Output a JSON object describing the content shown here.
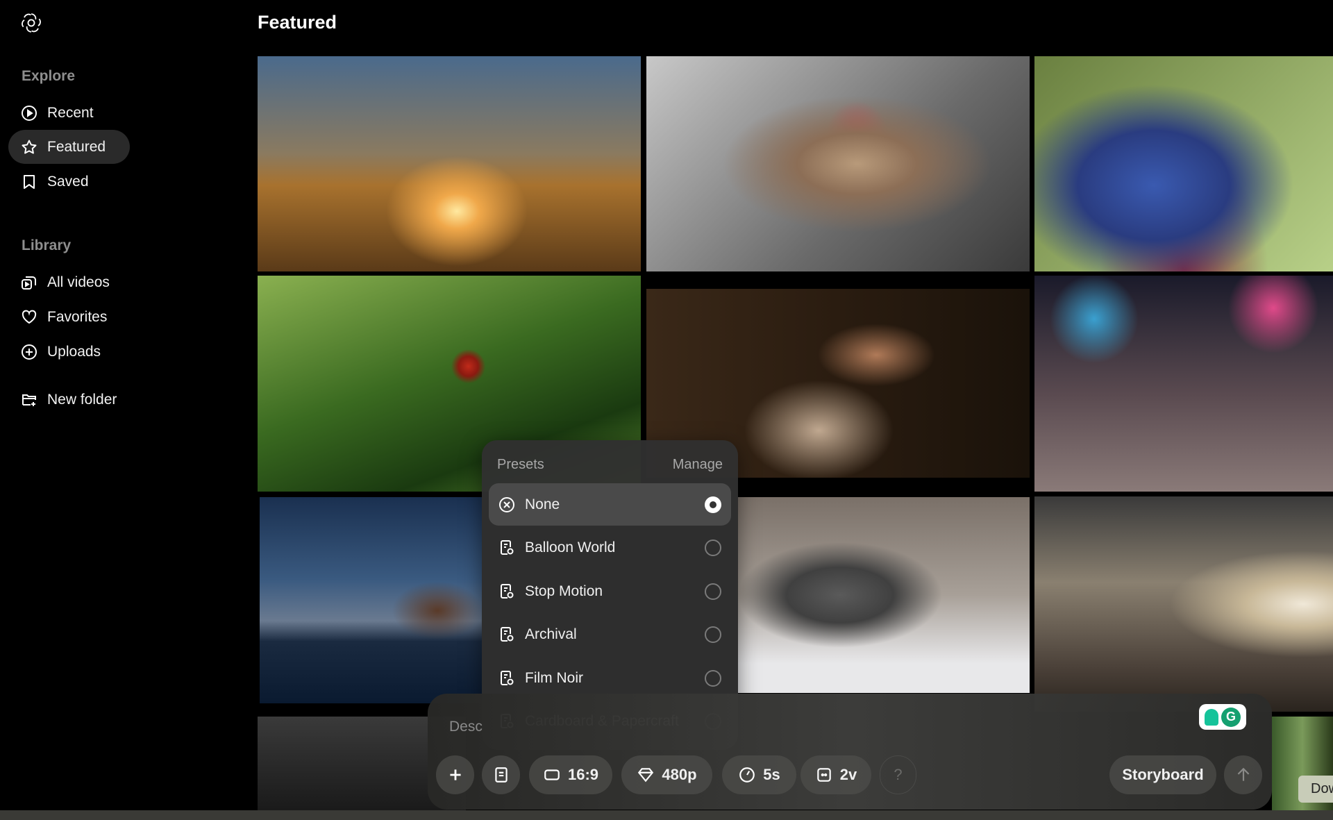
{
  "page_title": "Featured",
  "sidebar": {
    "explore_label": "Explore",
    "explore_items": [
      {
        "label": "Recent",
        "icon": "play-circle-icon"
      },
      {
        "label": "Featured",
        "icon": "star-icon",
        "active": true
      },
      {
        "label": "Saved",
        "icon": "bookmark-icon"
      }
    ],
    "library_label": "Library",
    "library_items": [
      {
        "label": "All videos",
        "icon": "videos-icon"
      },
      {
        "label": "Favorites",
        "icon": "heart-icon"
      },
      {
        "label": "Uploads",
        "icon": "plus-circle-icon"
      }
    ],
    "new_folder": "New folder"
  },
  "presets": {
    "header": "Presets",
    "manage": "Manage",
    "items": [
      {
        "label": "None",
        "selected": true
      },
      {
        "label": "Balloon World"
      },
      {
        "label": "Stop Motion"
      },
      {
        "label": "Archival"
      },
      {
        "label": "Film Noir"
      },
      {
        "label": "Cardboard & Papercraft"
      }
    ]
  },
  "composer": {
    "placeholder": "Desc",
    "aspect": "16:9",
    "resolution": "480p",
    "duration": "5s",
    "variations": "2v",
    "help": "?",
    "storyboard": "Storyboard"
  },
  "download_partial": "Dow"
}
